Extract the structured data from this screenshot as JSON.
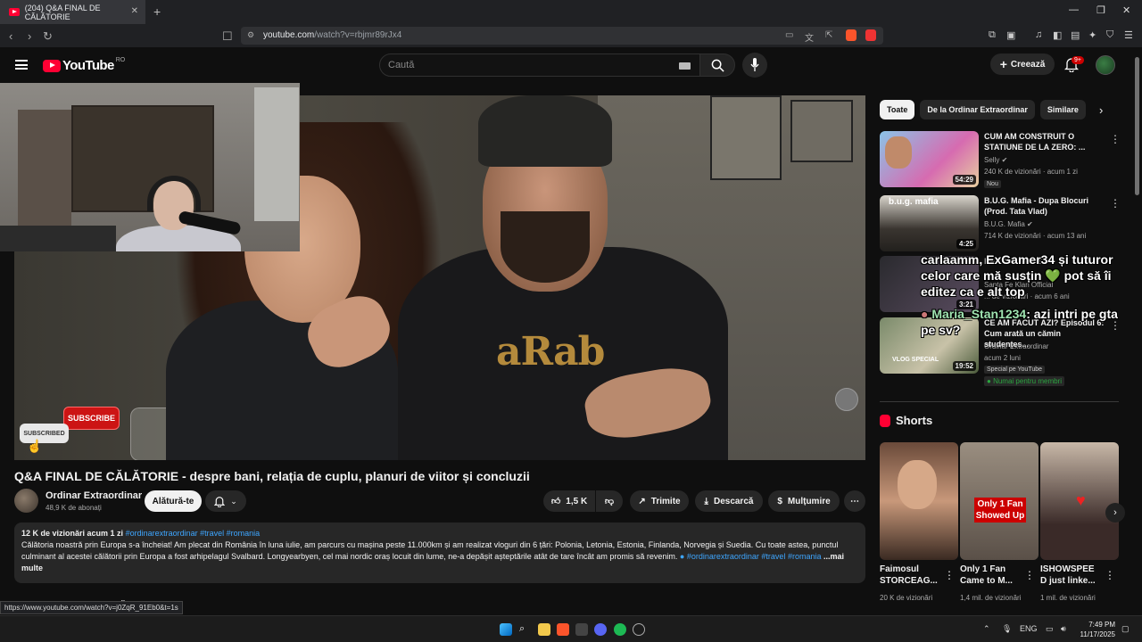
{
  "browser": {
    "tab_title": "(204) Q&A FINAL DE CĂLĂTORIE",
    "tab_close": "✕",
    "new_tab": "+",
    "url_host": "youtube.com",
    "url_path": "/watch?v=rbjmr89rJx4",
    "status_url": "https://www.youtube.com/watch?v=j0ZqR_91Eb0&t=1s"
  },
  "header": {
    "logo_text": "YouTube",
    "region": "RO",
    "search_placeholder": "Caută",
    "create_label": "Creează",
    "notif_count": "9+"
  },
  "overlay": {
    "subscribe_label": "SUBSCRIBE",
    "subscribed_label": "SUBSCRIBED"
  },
  "video": {
    "title": "Q&A FINAL DE CĂLĂTORIE - despre bani, relația de cuplu, planuri de viitor și concluzii",
    "channel": "Ordinar Extraordinar",
    "subscribers": "48,9 K de abonați",
    "join_label": "Alătură-te",
    "likes": "1,5 K",
    "share_label": "Trimite",
    "download_label": "Descarcă",
    "thanks_label": "Mulțumire",
    "desc_views": "12 K de vizionări  acum 1 zi",
    "desc_tags_top": "#ordinarextraordinar #travel #romania",
    "desc_text": "Călătoria noastră prin Europa s-a încheiat! Am plecat din România în luna iulie, am parcurs cu mașina peste 11.000km și am realizat vloguri din 6 țări: Polonia, Letonia, Estonia, Finlanda, Norvegia și Suedia. Cu toate astea, punctul culminant al acestei călătorii prin Europa a fost arhipelagul Svalbard. Longyearbyen, cel mai nordic oraș locuit din lume, ne-a depășit așteptările atât de tare încât am promis să revenim.",
    "desc_tags_inline": "#ordinarextraordinar #travel",
    "desc_tag_end": "#romania",
    "desc_more": "...mai multe",
    "next_fragment": "pă"
  },
  "sidebar": {
    "chips": [
      "Toate",
      "De la Ordinar Extraordinar",
      "Similare"
    ],
    "recs": [
      {
        "title": "CUM AM CONSTRUIT O STATIUNE DE LA ZERO: ...",
        "channel": "Selly",
        "info": "240 K de vizionări · acum 1 zi",
        "duration": "54:29",
        "badge": "Nou"
      },
      {
        "title": "B.U.G. Mafia - Dupa Blocuri (Prod. Tata Vlad)",
        "channel": "B.U.G. Mafia",
        "info": "714 K de vizionări · acum 13 ani",
        "duration": "4:25"
      },
      {
        "title": "RENDEZ-VOUS",
        "channel": "Santa Fe Klan Official",
        "info": "... de vizionări · acum 6 ani",
        "duration": "3:21"
      },
      {
        "title": "CE AM FACUT AZI? Episodul 6: Cum arată un cămin studențes...",
        "channel": "Ordinar Extraordinar",
        "info": "acum 2 luni",
        "duration": "19:52",
        "special": "Special pe YouTube",
        "members": "Numai pentru membri"
      }
    ],
    "chat": [
      {
        "user": "carlaamm",
        "msg": "ExGamer34 și tuturor celor care mă susțin 💚 pot să îi editez ca e alt top"
      },
      {
        "user": "Maria_Stan1234",
        "msg": "azi intri pe gta pe sv?"
      }
    ],
    "shorts_heading": "Shorts",
    "shorts": [
      {
        "title": "Faimosul STORCEAG...",
        "views": "20 K de vizionări",
        "overlay": ""
      },
      {
        "title": "Only 1 Fan Came to M...",
        "views": "1,4 mil. de vizionări",
        "overlay": "Only 1 Fan Showed Up"
      },
      {
        "title": "ISHOWSPEE D just linke...",
        "views": "1 mil. de vizionări",
        "overlay": ""
      }
    ]
  },
  "taskbar": {
    "lang": "ENG",
    "time": "7:49 PM",
    "date": "11/17/2025"
  },
  "colors": {
    "accent_red": "#ff0033",
    "link_blue": "#3ea6ff",
    "members_green": "#2ba640",
    "background": "#0f0f0f"
  }
}
